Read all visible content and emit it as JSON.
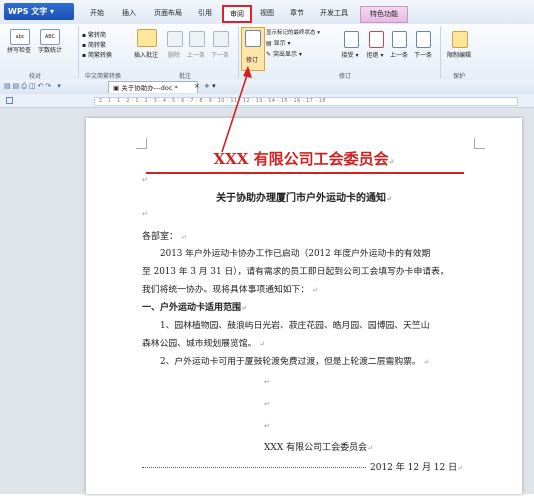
{
  "app": {
    "menu_button": "WPS 文字"
  },
  "tabs": [
    "开始",
    "插入",
    "页面布局",
    "引用",
    "审阅",
    "视图",
    "章节",
    "开发工具",
    "特色功能"
  ],
  "ribbon": {
    "spellcheck": "拼写检查",
    "wordcount": "字数统计",
    "proofread_group": "校对",
    "to_trad": "繁转简",
    "to_simp": "简转繁",
    "convert": "简繁转换",
    "chinese_group": "中文简繁转换",
    "insert_comment": "插入批注",
    "delete": "删除",
    "prev": "上一条",
    "next": "下一条",
    "comment_group": "批注",
    "track_changes": "修订",
    "show_markup_state": "显示标记的最终状态",
    "show": "显示",
    "highlight_changes": "突出显示",
    "accept": "接受",
    "reject": "拒绝",
    "prev2": "上一条",
    "next2": "下一条",
    "track_group": "修订",
    "restrict_edit": "限制编辑",
    "protect_group": "保护"
  },
  "doc_tab": {
    "title": "关于协助办---doc *",
    "close": "×",
    "add": "+"
  },
  "ruler_text": "· 2 · 1 · 1 · 2 · 1 · 2 · 3 · 4 · 5 · 6 · 7 · 8 · 9 · 10 · 11 · 12 · 13 · 14 · 15 · 16 · 17 · 18",
  "document": {
    "letterhead": "XXX 有限公司工会委员会",
    "title": "关于协助办理厦门市户外运动卡的通知",
    "salutation": "各部室：",
    "para1_line1": "2013 年户外运动卡协办工作已启动（2012 年度户外运动卡的有效期",
    "para1_line2": "至 2013 年 3 月 31 日），请有需求的员工即日起到公司工会填写办卡申请表，",
    "para1_line3": "我们将统一协办。现将具体事项通知如下：",
    "section1": "一、户外运动卡适用范围",
    "item1_line1": "1、园林植物园、鼓浪屿日光岩、菽庄花园、皓月园、园博园、天竺山",
    "item1_line2": "森林公园、城市规划展览馆。",
    "item2": "2、户外运动卡可用于厦鼓轮渡免费过渡，但是上轮渡二层需购票。",
    "signature": "XXX 有限公司工会委员会",
    "date": "2012 年 12 月 12 日",
    "para_mark": "↵"
  },
  "colors": {
    "red": "#d42020",
    "highlight": "#e0202a"
  }
}
